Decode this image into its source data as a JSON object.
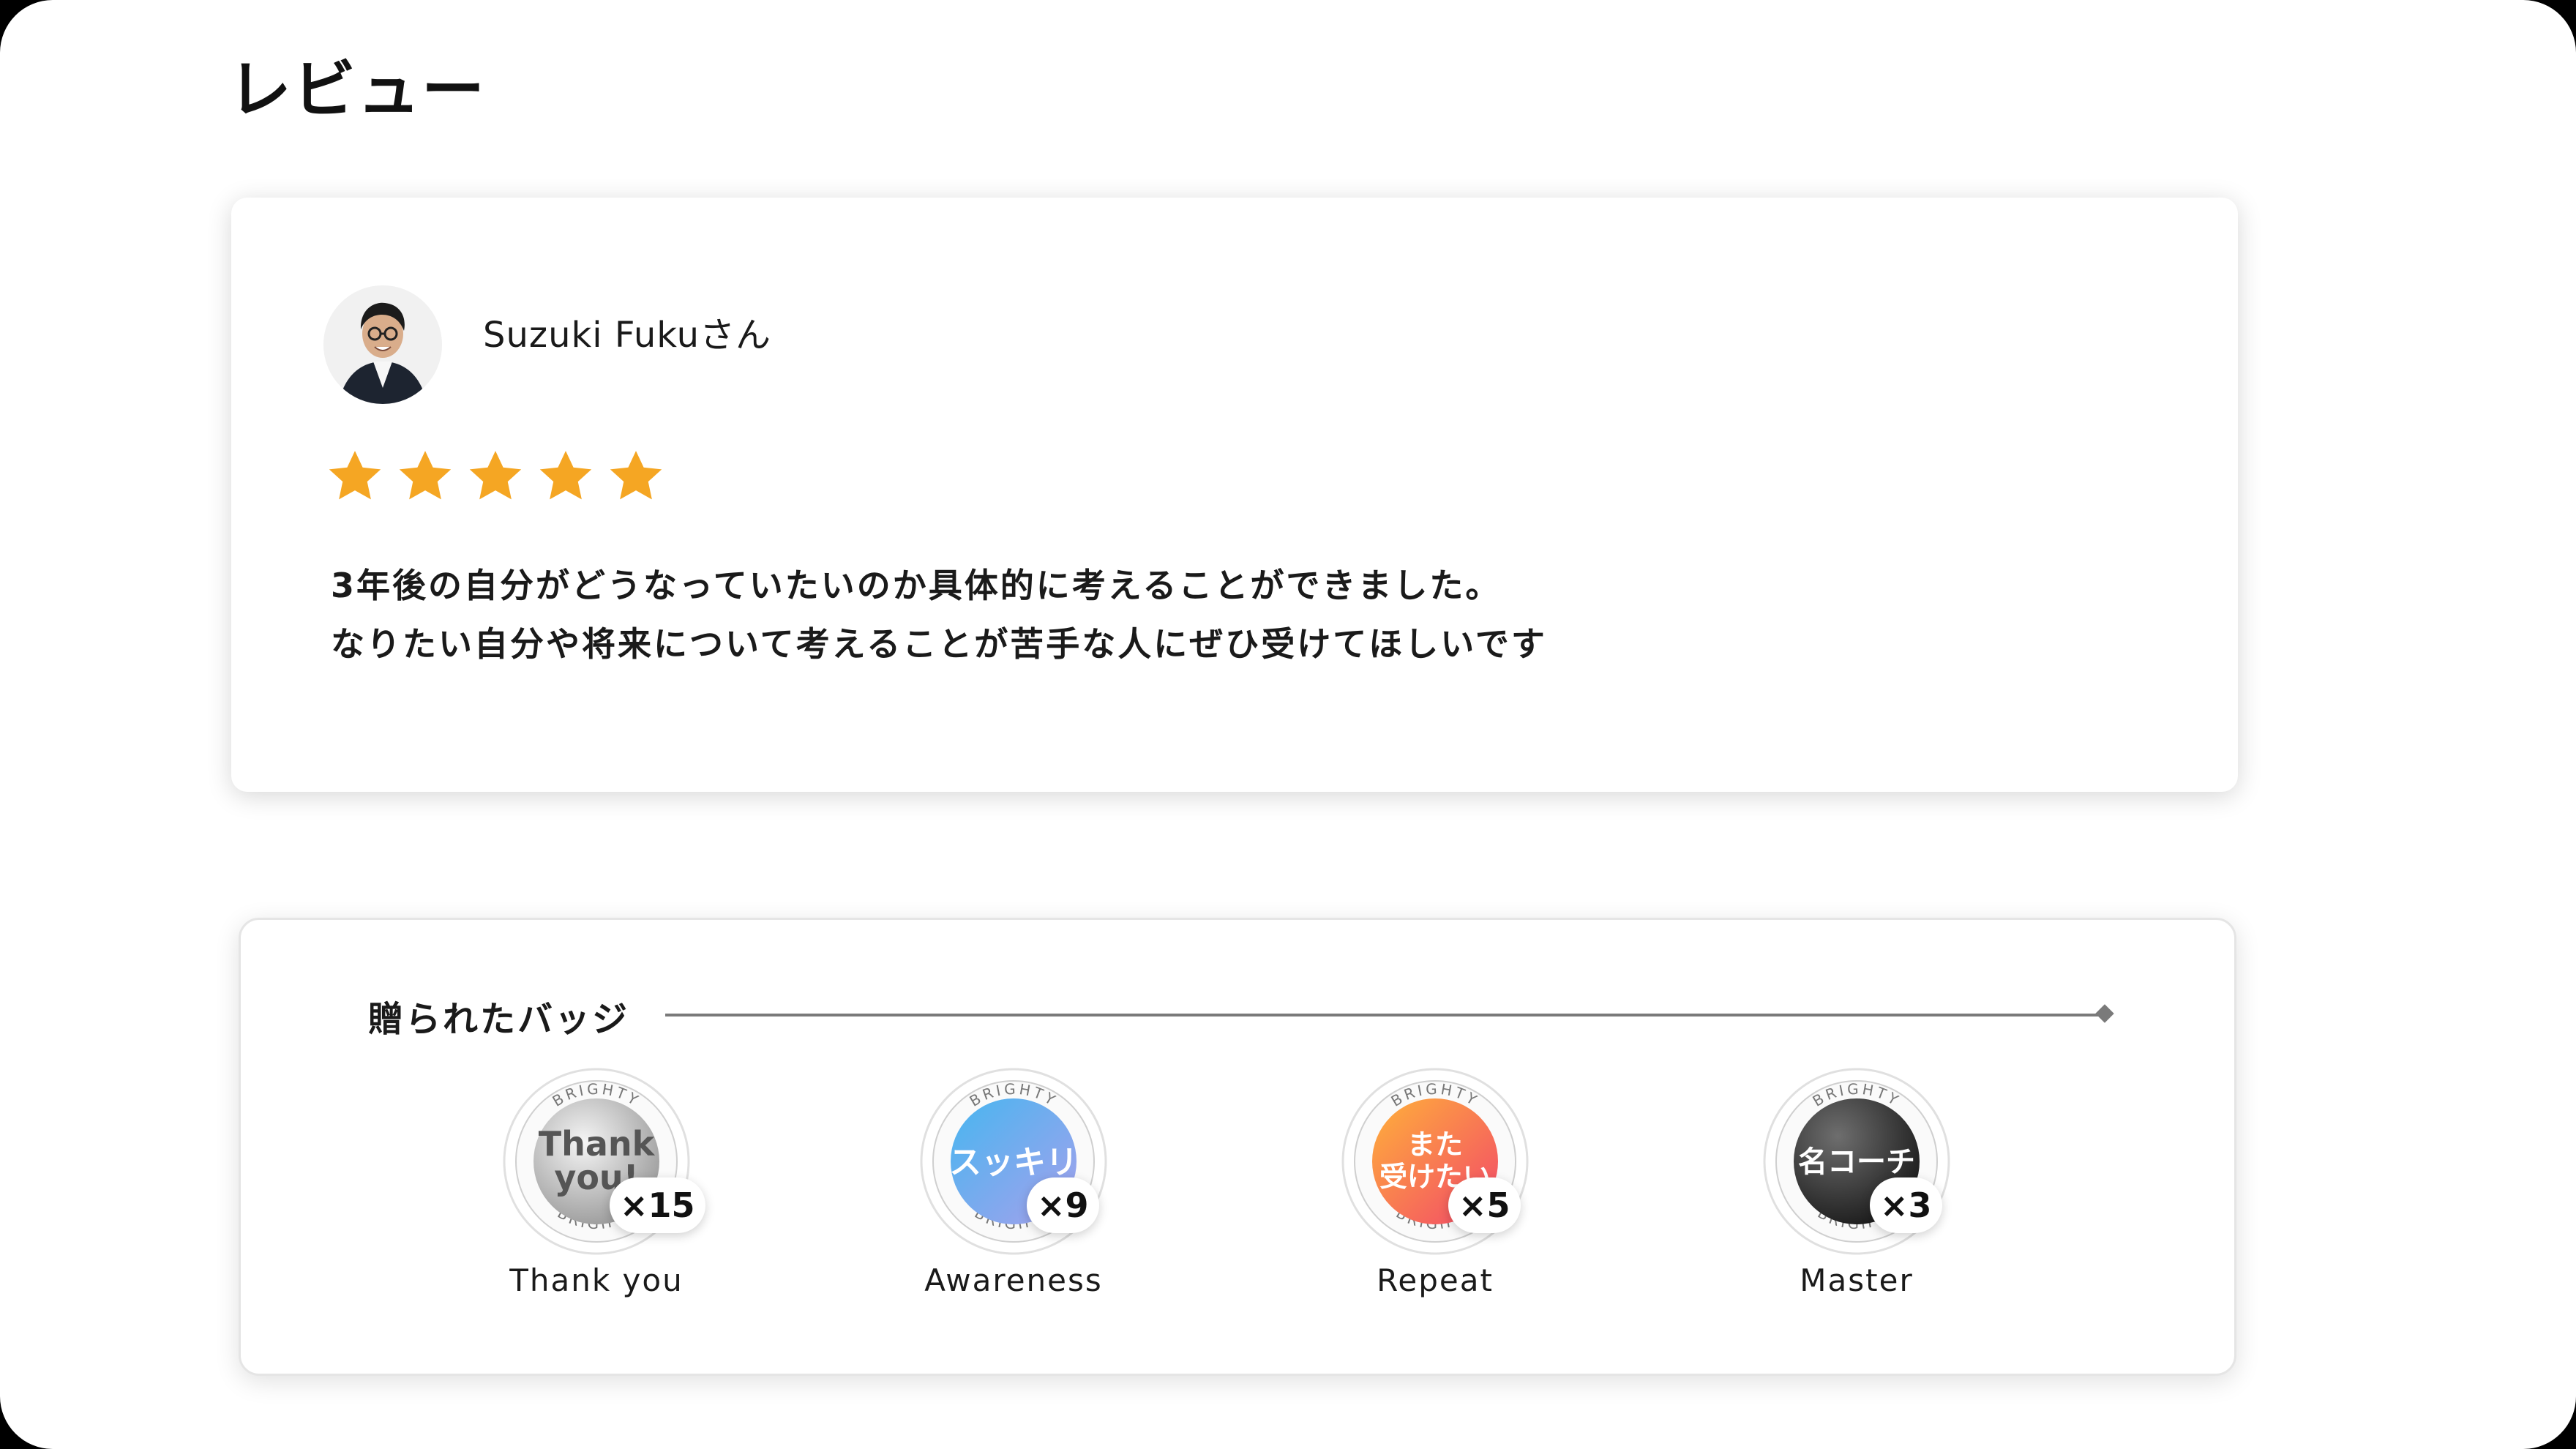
{
  "page": {
    "title": "レビュー"
  },
  "review": {
    "reviewer_name": "Suzuki Fukuさん",
    "rating": 5,
    "rating_max": 5,
    "star_color": "#F5A623",
    "lines": [
      "3年後の自分がどうなっていたいのか具体的に考えることができました。",
      "なりたい自分や将来について考えることが苦手な人にぜひ受けてほしいです"
    ]
  },
  "badges": {
    "title": "贈られたバッジ",
    "ring_text": "BRIGHTY",
    "items": [
      {
        "face": [
          "Thank",
          "you!"
        ],
        "count": "×15",
        "label": "Thank you",
        "icon": "thank-you-badge-icon"
      },
      {
        "face": [
          "スッキリ"
        ],
        "count": "×9",
        "label": "Awareness",
        "icon": "awareness-badge-icon"
      },
      {
        "face": [
          "また",
          "受けたい"
        ],
        "count": "×5",
        "label": "Repeat",
        "icon": "repeat-badge-icon"
      },
      {
        "face": [
          "名コーチ"
        ],
        "count": "×3",
        "label": "Master",
        "icon": "master-badge-icon"
      }
    ]
  }
}
